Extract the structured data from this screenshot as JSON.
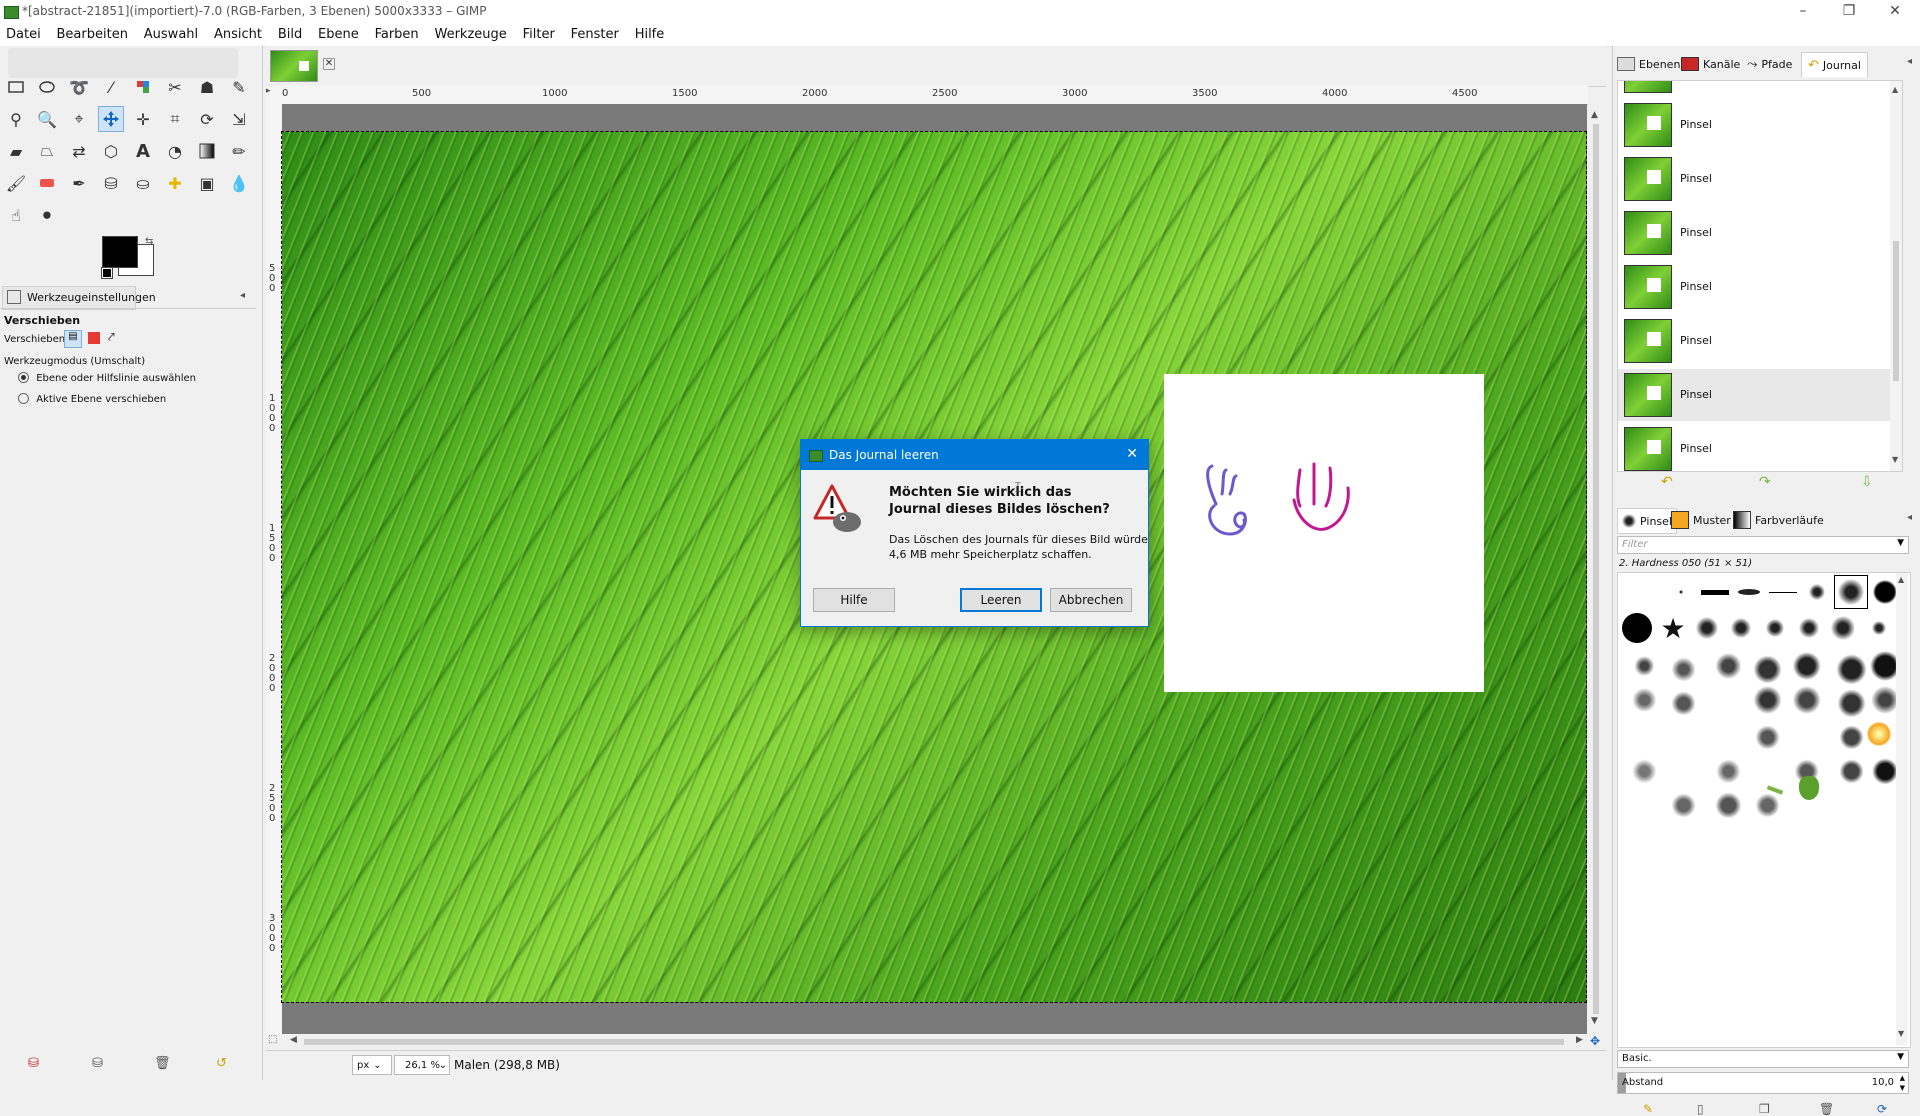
{
  "window": {
    "title": "*[abstract-21851](importiert)-7.0 (RGB-Farben, 3 Ebenen) 5000x3333 – GIMP",
    "minimize": "–",
    "maximize": "❐",
    "close": "✕"
  },
  "menu": [
    "Datei",
    "Bearbeiten",
    "Auswahl",
    "Ansicht",
    "Bild",
    "Ebene",
    "Farben",
    "Werkzeuge",
    "Filter",
    "Fenster",
    "Hilfe"
  ],
  "tool_options": {
    "tab_label": "Werkzeugeinstellungen",
    "tool_name": "Verschieben",
    "move_label": "Verschieben:",
    "mode_label": "Werkzeugmodus (Umschalt)",
    "option_1": "Ebene oder Hilfslinie auswählen",
    "option_2": "Aktive Ebene verschieben",
    "selected_option": 1
  },
  "ruler": {
    "h_ticks": [
      "0",
      "500",
      "1000",
      "1500",
      "2000",
      "2500",
      "3000",
      "3500",
      "4000",
      "4500"
    ],
    "v_ticks": [
      "5 0 0",
      "1 0 0 0",
      "1 5 0 0",
      "2 0 0 0",
      "2 5 0 0",
      "3 0 0 0"
    ]
  },
  "status": {
    "unit": "px",
    "zoom": "26,1 %",
    "message": "Malen (298,8 MB)"
  },
  "right_dock": {
    "tabs": [
      "Ebenen",
      "Kanäle",
      "Pfade",
      "Journal"
    ],
    "history_items": [
      "Pinsel",
      "Pinsel",
      "Pinsel",
      "Pinsel",
      "Pinsel",
      "Pinsel",
      "Pinsel"
    ],
    "selected_history_index": 5,
    "brush_tabs": [
      "Pinsel",
      "Muster",
      "Farbverläufe"
    ],
    "filter_placeholder": "Filter",
    "brush_name": "2. Hardness 050 (51 × 51)",
    "brush_set": "Basic.",
    "spacing_label": "Abstand",
    "spacing_value": "10,0"
  },
  "dialog": {
    "title": "Das Journal leeren",
    "heading_line1": "Möchten Sie wirklich das",
    "heading_line2": "Journal dieses Bildes löschen?",
    "body_line1": "Das Löschen des Journals für dieses Bild würde",
    "body_line2": "4,6 MB mehr Speicherplatz schaffen.",
    "btn_help": "Hilfe",
    "btn_clear": "Leeren",
    "btn_cancel": "Abbrechen"
  },
  "colors": {
    "accent": "#0078d7",
    "foreground": "#000000",
    "background": "#ffffff"
  }
}
